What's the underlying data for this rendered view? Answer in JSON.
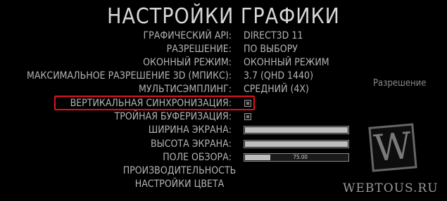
{
  "title": "НАСТРОЙКИ ГРАФИКИ",
  "settings": [
    {
      "label": "ГРАФИЧЕСКИЙ API:",
      "value": "DIRECT3D 11"
    },
    {
      "label": "РАЗРЕШЕНИЕ:",
      "value": "ПО ВЫБОРУ"
    },
    {
      "label": "ОКОННЫЙ РЕЖИМ:",
      "value": "ОКОННЫЙ РЕЖИМ"
    },
    {
      "label": "МАКСИМАЛЬНОЕ РАЗРЕШЕНИЕ 3D (МПИКС):",
      "value": "3.7 (QHD 1440)"
    },
    {
      "label": "МУЛЬТИСЭМПЛИНГ:",
      "value": "СРЕДНИЙ (4X)"
    },
    {
      "label": "ВЕРТИКАЛЬНАЯ СИНХРОНИЗАЦИЯ:",
      "checked": true
    },
    {
      "label": "ТРОЙНАЯ БУФЕРИЗАЦИЯ:",
      "checked": true
    },
    {
      "label": "ШИРИНА ЭКРАНА:",
      "slider_level": 1.0
    },
    {
      "label": "ВЫСОТА ЭКРАНА:",
      "slider_level": 1.0
    },
    {
      "label": "ПОЛЕ ОБЗОРА:",
      "slider_level": 0.26,
      "slider_value": "75.00"
    }
  ],
  "menu": {
    "performance": "ПРОИЗВОДИТЕЛЬНОСТЬ",
    "color": "НАСТРОЙКИ ЦВЕТА"
  },
  "side_panel": {
    "heading": "Разрешение"
  },
  "watermark": {
    "logo_letter": "W",
    "site": "WEBTOUS.RU"
  },
  "colors": {
    "background": "#000000",
    "text": "#b4b4b4",
    "highlight": "#e0141e"
  }
}
